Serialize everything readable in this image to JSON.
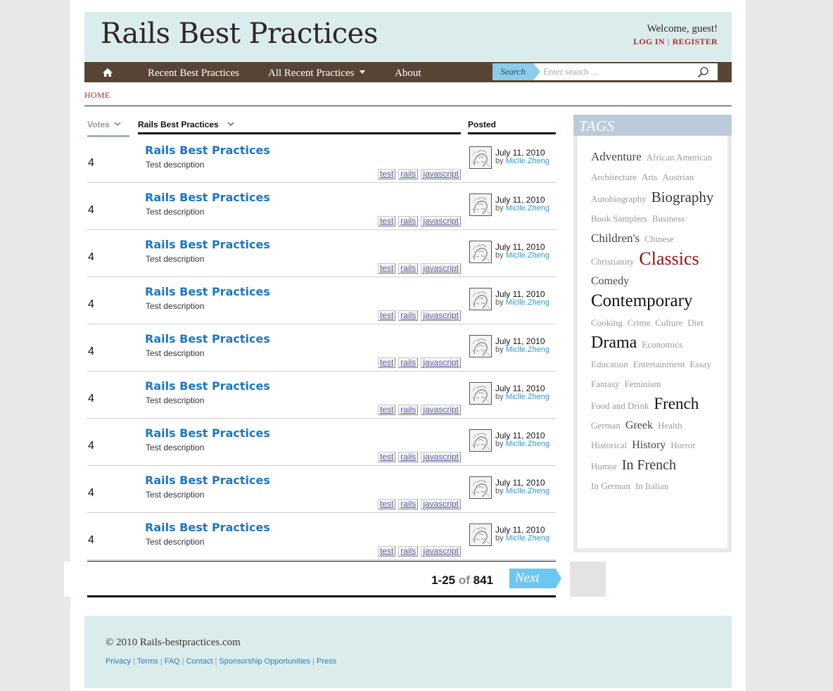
{
  "header": {
    "title": "Rails Best Practices",
    "welcome": "Welcome, guest!",
    "login": "LOG IN",
    "register": "REGISTER"
  },
  "nav": {
    "items": [
      "Recent Best Practices",
      "All Recent Practices",
      "About"
    ],
    "search_label": "Search",
    "search_placeholder": "Enter search ..."
  },
  "breadcrumb": "HOME",
  "list": {
    "headers": {
      "votes": "Votes",
      "title": "Rails Best Practices",
      "posted": "Posted"
    },
    "rows": [
      {
        "votes": "4",
        "title": "Rails Best Practices",
        "desc": "Test description",
        "tags": [
          "test",
          "rails",
          "javascript"
        ],
        "date": "July 11, 2010",
        "by": "by",
        "author": "Miclle.Zheng"
      },
      {
        "votes": "4",
        "title": "Rails Best Practices",
        "desc": "Test description",
        "tags": [
          "test",
          "rails",
          "javascript"
        ],
        "date": "July 11, 2010",
        "by": "by",
        "author": "Miclle.Zheng"
      },
      {
        "votes": "4",
        "title": "Rails Best Practices",
        "desc": "Test description",
        "tags": [
          "test",
          "rails",
          "javascript"
        ],
        "date": "July 11, 2010",
        "by": "by",
        "author": "Miclle.Zheng"
      },
      {
        "votes": "4",
        "title": "Rails Best Practices",
        "desc": "Test description",
        "tags": [
          "test",
          "rails",
          "javascript"
        ],
        "date": "July 11, 2010",
        "by": "by",
        "author": "Miclle.Zheng"
      },
      {
        "votes": "4",
        "title": "Rails Best Practices",
        "desc": "Test description",
        "tags": [
          "test",
          "rails",
          "javascript"
        ],
        "date": "July 11, 2010",
        "by": "by",
        "author": "Miclle.Zheng"
      },
      {
        "votes": "4",
        "title": "Rails Best Practices",
        "desc": "Test description",
        "tags": [
          "test",
          "rails",
          "javascript"
        ],
        "date": "July 11, 2010",
        "by": "by",
        "author": "Miclle.Zheng"
      },
      {
        "votes": "4",
        "title": "Rails Best Practices",
        "desc": "Test description",
        "tags": [
          "test",
          "rails",
          "javascript"
        ],
        "date": "July 11, 2010",
        "by": "by",
        "author": "Miclle.Zheng"
      },
      {
        "votes": "4",
        "title": "Rails Best Practices",
        "desc": "Test description",
        "tags": [
          "test",
          "rails",
          "javascript"
        ],
        "date": "July 11, 2010",
        "by": "by",
        "author": "Miclle.Zheng"
      },
      {
        "votes": "4",
        "title": "Rails Best Practices",
        "desc": "Test description",
        "tags": [
          "test",
          "rails",
          "javascript"
        ],
        "date": "July 11, 2010",
        "by": "by",
        "author": "Miclle.Zheng"
      }
    ]
  },
  "pager": {
    "range": "1-25",
    "of": "of",
    "total": "841",
    "next": "Next"
  },
  "tags_panel": {
    "title": "TAGS",
    "cloud": [
      {
        "name": "Adventure",
        "size": 17,
        "color": "#4a4540"
      },
      {
        "name": "African American",
        "size": 13,
        "color": "#9a9a9a"
      },
      {
        "name": "Architecture",
        "size": 13,
        "color": "#9a9a9a"
      },
      {
        "name": "Arts",
        "size": 13,
        "color": "#9a9a9a"
      },
      {
        "name": "Austrian",
        "size": 13,
        "color": "#9a9a9a"
      },
      {
        "name": "Autobiography",
        "size": 13,
        "color": "#9a9a9a"
      },
      {
        "name": "Biography",
        "size": 21,
        "color": "#3a3530"
      },
      {
        "name": "Book Samplers",
        "size": 13,
        "color": "#9a9a9a"
      },
      {
        "name": "Business",
        "size": 13,
        "color": "#9a9a9a"
      },
      {
        "name": "Children's",
        "size": 17,
        "color": "#4a4540"
      },
      {
        "name": "Chinese",
        "size": 13,
        "color": "#9a9a9a"
      },
      {
        "name": "Christianity",
        "size": 13,
        "color": "#9a9a9a"
      },
      {
        "name": "Classics",
        "size": 26,
        "color": "#8b1010"
      },
      {
        "name": "Comedy",
        "size": 16,
        "color": "#4a4540"
      },
      {
        "name": "Contemporary",
        "size": 25,
        "color": "#111111"
      },
      {
        "name": "Cooking",
        "size": 13,
        "color": "#9a9a9a"
      },
      {
        "name": "Crime",
        "size": 13,
        "color": "#9a9a9a"
      },
      {
        "name": "Culture",
        "size": 13,
        "color": "#9a9a9a"
      },
      {
        "name": "Diet",
        "size": 13,
        "color": "#9a9a9a"
      },
      {
        "name": "Drama",
        "size": 24,
        "color": "#111111"
      },
      {
        "name": "Economics",
        "size": 13,
        "color": "#9a9a9a"
      },
      {
        "name": "Education",
        "size": 13,
        "color": "#9a9a9a"
      },
      {
        "name": "Entertainment",
        "size": 13,
        "color": "#9a9a9a"
      },
      {
        "name": "Essay",
        "size": 13,
        "color": "#9a9a9a"
      },
      {
        "name": "Fantasy",
        "size": 13,
        "color": "#9a9a9a"
      },
      {
        "name": "Feminism",
        "size": 13,
        "color": "#9a9a9a"
      },
      {
        "name": "Food and Drink",
        "size": 13,
        "color": "#9a9a9a"
      },
      {
        "name": "French",
        "size": 23,
        "color": "#111111"
      },
      {
        "name": "German",
        "size": 13,
        "color": "#9a9a9a"
      },
      {
        "name": "Greek",
        "size": 16,
        "color": "#4a4540"
      },
      {
        "name": "Health",
        "size": 13,
        "color": "#9a9a9a"
      },
      {
        "name": "Historical",
        "size": 13,
        "color": "#9a9a9a"
      },
      {
        "name": "History",
        "size": 16,
        "color": "#4a4540"
      },
      {
        "name": "Horror",
        "size": 13,
        "color": "#9a9a9a"
      },
      {
        "name": "Humor",
        "size": 13,
        "color": "#9a9a9a"
      },
      {
        "name": "In French",
        "size": 20,
        "color": "#3a3530"
      },
      {
        "name": "In German",
        "size": 13,
        "color": "#9a9a9a"
      },
      {
        "name": "In Italian",
        "size": 13,
        "color": "#9a9a9a"
      }
    ]
  },
  "footer": {
    "copyright": "© 2010 Rails-bestpractices.com",
    "links": [
      "Privacy",
      "Terms",
      "FAQ",
      "Contact",
      "Sponsorship Opportunities",
      "Press"
    ]
  }
}
